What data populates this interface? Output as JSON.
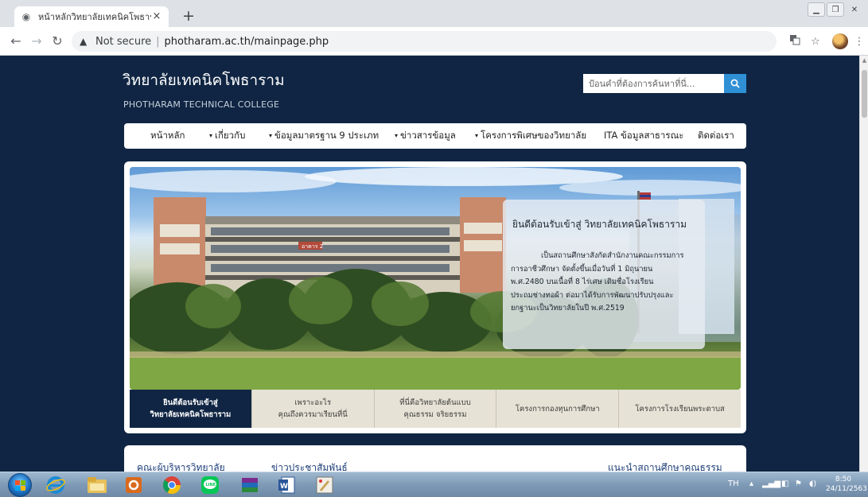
{
  "browser": {
    "tab_title": "หน้าหลักวิทยาลัยเทคนิคโพธาราม",
    "tab_close": "×",
    "new_tab": "+",
    "security_label": "Not secure",
    "url": "photharam.ac.th/mainpage.php"
  },
  "site": {
    "title": "วิทยาลัยเทคนิคโพธาราม",
    "subtitle": "PHOTHARAM TECHNICAL COLLEGE",
    "search_placeholder": "ป้อนคำที่ต้องการค้นหาที่นี่..."
  },
  "nav": {
    "items": [
      {
        "label": "หน้าหลัก",
        "caret": ""
      },
      {
        "label": "เกี่ยวกับ",
        "caret": "▾"
      },
      {
        "label": "ข้อมูลมาตรฐาน 9 ประเภท",
        "caret": "▾"
      },
      {
        "label": "ข่าวสารข้อมูล",
        "caret": "▾"
      },
      {
        "label": "โครงการพิเศษของวิทยาลัย",
        "caret": "▾"
      },
      {
        "label": "ITA ข้อมูลสาธารณะ",
        "caret": ""
      },
      {
        "label": "ติดต่อเรา",
        "caret": ""
      }
    ]
  },
  "hero": {
    "heading": "ยินดีต้อนรับเข้าสู่ วิทยาลัยเทคนิคโพธาราม",
    "lines": [
      "เป็นสถานศึกษาสังกัดสำนักงานคณะกรรมการ",
      "การอาชีวศึกษา จัดตั้งขึ้นเมื่อวันที่ 1 มิถุนายน",
      "พ.ศ.2480 บนเนื้อที่ 8 ไร่เศษ เดิมชื่อโรงเรียน",
      "ประถมช่างทอผ้า ต่อมาได้รับการพัฒนาปรับปรุงและ",
      "ยกฐานะเป็นวิทยาลัยในปี พ.ศ.2519"
    ],
    "building_sign": "อาคาร 2"
  },
  "slider_tabs": [
    {
      "line1": "ยินดีต้อนรับเข้าสู่",
      "line2": "วิทยาลัยเทคนิคโพธาราม",
      "active": true
    },
    {
      "line1": "เพราะอะไร",
      "line2": "คุณถึงควรมาเรียนที่นี่",
      "active": false
    },
    {
      "line1": "ที่นี่คือวิทยาลัยต้นแบบ",
      "line2": "คุณธรรม จริยธรรม",
      "active": false
    },
    {
      "line1": "โครงการกองทุนการศึกษา",
      "line2": "",
      "active": false
    },
    {
      "line1": "โครงการโรงเรียนพระดาบส",
      "line2": "",
      "active": false
    }
  ],
  "bottom_links": [
    "คณะผู้บริหารวิทยาลัย",
    "ข่าวประชาสัมพันธ์",
    "แนะนำสถานศึกษาคุณธรรม"
  ],
  "taskbar": {
    "lang": "TH",
    "time": "8:50",
    "date": "24/11/2563"
  }
}
